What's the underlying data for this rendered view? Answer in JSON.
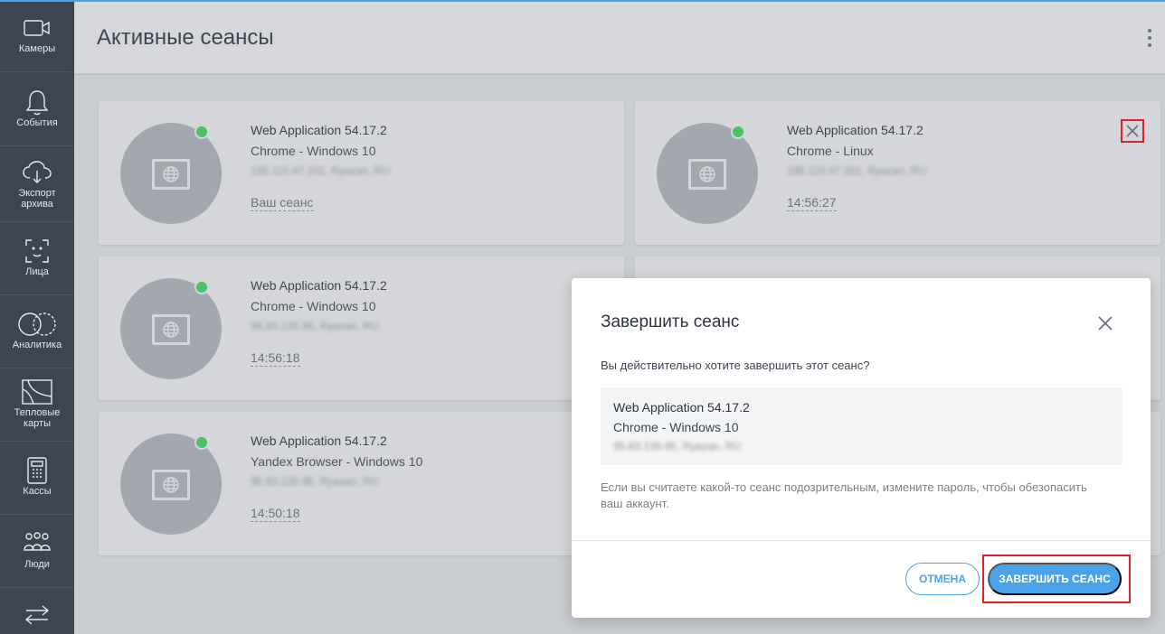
{
  "sidebar": {
    "items": [
      {
        "label": "Камеры",
        "icon": "camera-icon"
      },
      {
        "label": "События",
        "icon": "bell-icon"
      },
      {
        "label": "Экспорт архива",
        "icon": "cloud-download-icon"
      },
      {
        "label": "Лица",
        "icon": "face-scan-icon"
      },
      {
        "label": "Аналитика",
        "icon": "analytics-icon"
      },
      {
        "label": "Тепловые карты",
        "icon": "heatmap-icon"
      },
      {
        "label": "Кассы",
        "icon": "cash-register-icon"
      },
      {
        "label": "Люди",
        "icon": "people-icon"
      },
      {
        "label": "",
        "icon": "transfer-arrows-icon"
      }
    ]
  },
  "header": {
    "title": "Активные сеансы"
  },
  "sessions": [
    {
      "title": "Web Application 54.17.2",
      "client": "Chrome - Windows 10",
      "ip": "195.110.47.201, Ryazan, RU",
      "time": "Ваш сеанс"
    },
    {
      "title": "Web Application 54.17.2",
      "client": "Chrome - Linux",
      "ip": "195.110.47.201, Ryazan, RU",
      "time": "14:56:27"
    },
    {
      "title": "Web Application 54.17.2",
      "client": "Chrome - Windows 10",
      "ip": "95.83.135.95, Ryazan, RU",
      "time": "14:56:18"
    },
    {
      "title": "Web Application 54.17.2",
      "client": "Yandex Browser - Windows 10",
      "ip": "95.83.135.95, Ryazan, RU",
      "time": "14:50:18"
    }
  ],
  "modal": {
    "title": "Завершить сеанс",
    "question": "Вы действительно хотите завершить этот сеанс?",
    "session_title": "Web Application 54.17.2",
    "session_client": "Chrome - Windows 10",
    "session_ip": "95.83.135.95, Ryazan, RU",
    "note": "Если вы считаете какой-то сеанс подозрительным, измените пароль, чтобы обезопасить ваш аккаунт.",
    "cancel_label": "ОТМЕНА",
    "confirm_label": "ЗАВЕРШИТЬ СЕАНС"
  },
  "colors": {
    "accent": "#4aa3e8",
    "online": "#4cc06b",
    "highlight": "#e0202a",
    "sidebar": "#3d4552"
  }
}
